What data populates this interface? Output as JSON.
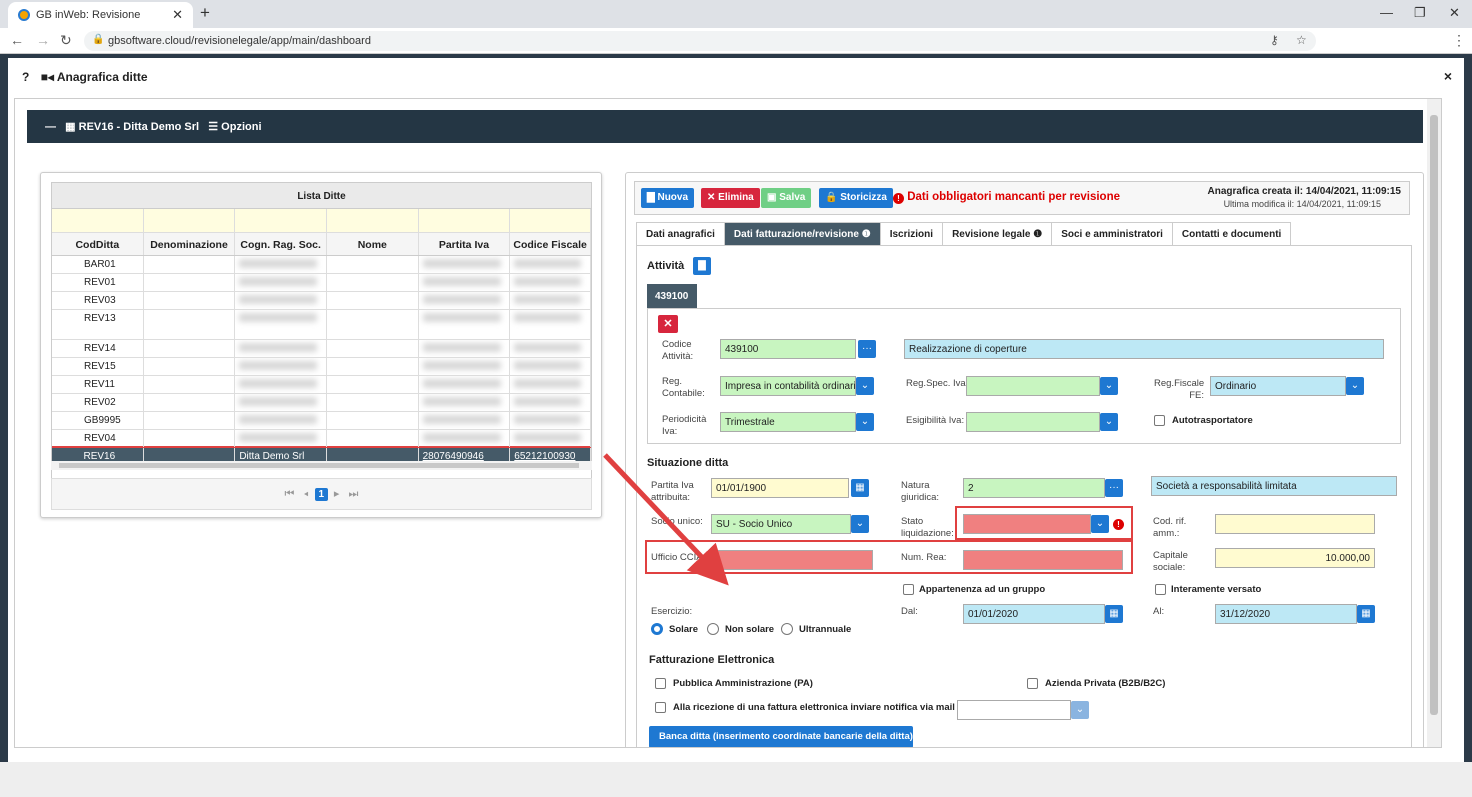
{
  "browser": {
    "tab_title": "GB inWeb: Revisione",
    "url": "gbsoftware.cloud/revisionelegale/app/main/dashboard"
  },
  "modal": {
    "title": "Anagrafica ditte",
    "help": "?"
  },
  "topbar": {
    "company": "REV16 - Ditta Demo Srl",
    "options": "Opzioni"
  },
  "list": {
    "title": "Lista Ditte",
    "columns": [
      "CodDitta",
      "Denominazione",
      "Cogn. Rag. Soc.",
      "Nome",
      "Partita Iva",
      "Codice Fiscale"
    ],
    "rows": [
      "BAR01",
      "REV01",
      "REV03",
      "REV13",
      "REV14",
      "REV15",
      "REV11",
      "REV02",
      "GB9995",
      "REV04"
    ],
    "selected": {
      "code": "REV16",
      "name": "Ditta Demo Srl",
      "piva": "28076490946",
      "cf": "65212100930"
    },
    "page": "1"
  },
  "toolbar": {
    "new": "Nuova",
    "delete": "Elimina",
    "save": "Salva",
    "history": "Storicizza",
    "warning": "Dati obbligatori mancanti per revisione",
    "created": "Anagrafica creata il: 14/04/2021, 11:09:15",
    "modified": "Ultima modifica il: 14/04/2021, 11:09:15"
  },
  "tabs": [
    "Dati anagrafici",
    "Dati fatturazione/revisione",
    "Iscrizioni",
    "Revisione legale",
    "Soci e amministratori",
    "Contatti e documenti"
  ],
  "attivita": {
    "title": "Attività",
    "tab": "439100",
    "codice_label": "Codice Attività:",
    "codice": "439100",
    "descr": "Realizzazione di coperture",
    "reg_cont_label": "Reg. Contabile:",
    "reg_cont": "Impresa in contabilità ordinaria",
    "reg_spec_label": "Reg.Spec. Iva:",
    "reg_fisc_label": "Reg.Fiscale FE:",
    "reg_fisc": "Ordinario",
    "period_label": "Periodicità Iva:",
    "period": "Trimestrale",
    "esig_label": "Esigibilità Iva:",
    "autotrasp": "Autotrasportatore"
  },
  "situazione": {
    "title": "Situazione ditta",
    "piva_label": "Partita Iva attribuita:",
    "piva_date": "01/01/1900",
    "natura_label": "Natura giuridica:",
    "natura": "2",
    "natura_descr": "Società a responsabilità limitata",
    "socio_label": "Socio unico:",
    "socio": "SU - Socio Unico",
    "stato_label": "Stato liquidazione:",
    "codrif_label": "Cod. rif. amm.:",
    "ufficio_label": "Ufficio CCIAA:",
    "rea_label": "Num. Rea:",
    "capitale_label": "Capitale sociale:",
    "capitale": "10.000,00",
    "gruppo": "Appartenenza ad un gruppo",
    "versato": "Interamente versato",
    "esercizio_label": "Esercizio:",
    "solare": "Solare",
    "nonsolare": "Non solare",
    "ultra": "Ultrannuale",
    "dal_label": "Dal:",
    "dal": "01/01/2020",
    "al_label": "Al:",
    "al": "31/12/2020"
  },
  "fatt": {
    "title": "Fatturazione Elettronica",
    "pa": "Pubblica Amministrazione (PA)",
    "b2b": "Azienda Privata (B2B/B2C)",
    "notify": "Alla ricezione di una fattura elettronica inviare notifica via mail a",
    "bank": "Banca ditta (inserimento coordinate bancarie della ditta)"
  }
}
